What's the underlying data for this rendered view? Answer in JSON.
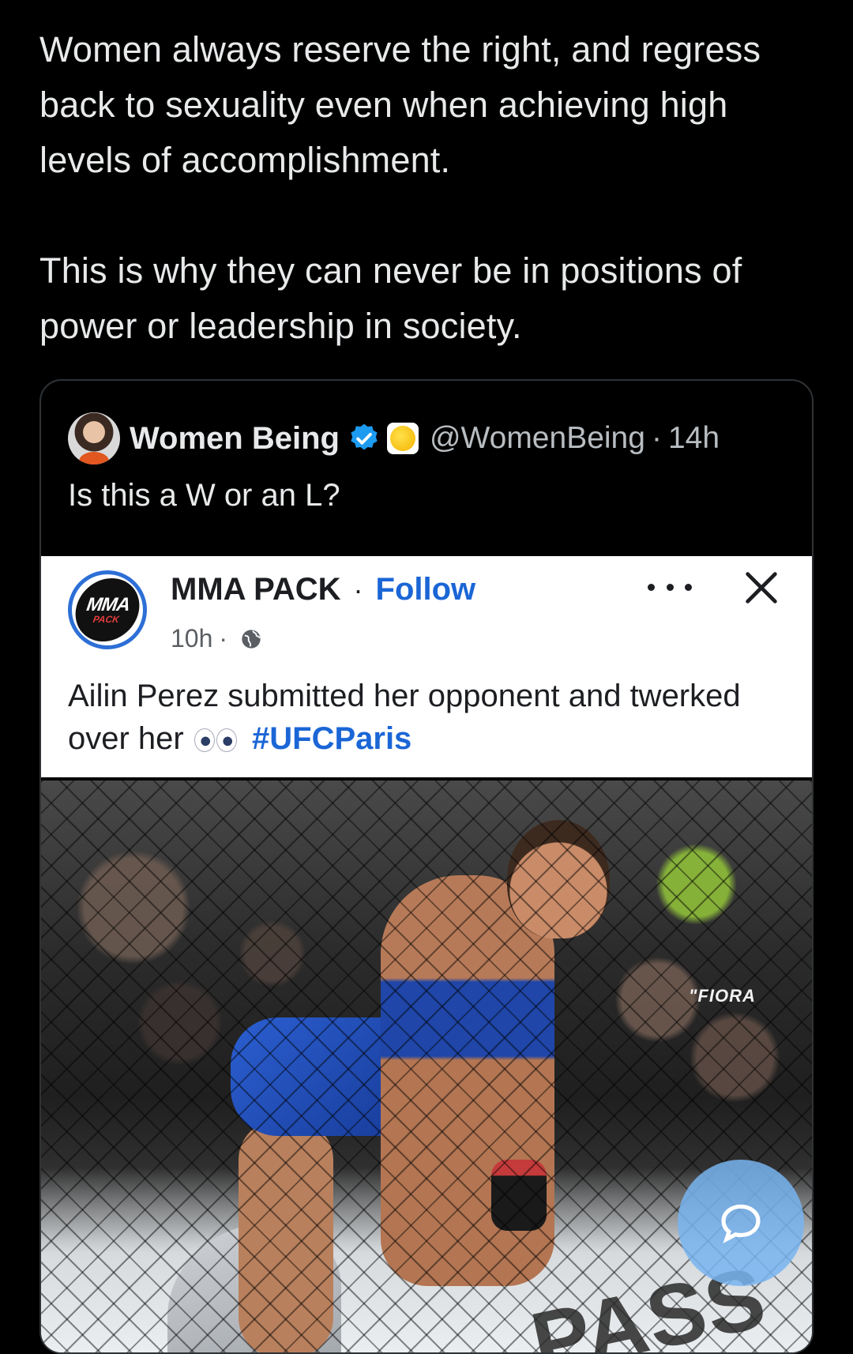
{
  "post": {
    "paragraph_1": "Women always reserve the right, and regress back to sexuality even when achieving high levels of accomplishment.",
    "paragraph_2": "This is why they can never be in positions of power or leadership in society."
  },
  "quoted_tweet": {
    "display_name": "Women Being",
    "handle": "@WomenBeing",
    "separator": "·",
    "time": "14h",
    "text": "Is this a W or an L?",
    "verified_color": "#1d9bf0"
  },
  "embedded_post": {
    "page_name": "MMA PACK",
    "separator": "·",
    "follow_label": "Follow",
    "time": "10h",
    "meta_separator": "·",
    "avatar_logo_top": "MMA",
    "avatar_logo_bottom": "PACK",
    "text_part_1": "Ailin Perez submitted her opponent and twerked over her",
    "hashtag": "#UFCParis",
    "link_color": "#1b66d6"
  },
  "photo": {
    "sponsor_text": "\"FIORA",
    "mat_text": "PASS"
  },
  "icons": {
    "verified": "verified-badge-icon",
    "emoji": "yellow-circle-icon",
    "globe": "globe-icon",
    "more": "more-options-icon",
    "close": "close-icon",
    "eyes": "eyes-emoji-icon",
    "chat": "chat-bubble-icon"
  }
}
